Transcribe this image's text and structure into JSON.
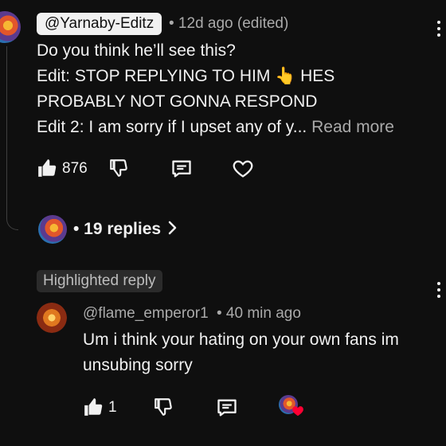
{
  "comment": {
    "author_handle": "@Yarnaby-Editz",
    "meta": "• 12d ago (edited)",
    "lines": [
      "Do you think he’ll see this?",
      "Edit: STOP REPLYING TO HIM 👆  HES",
      "PROBABLY NOT GONNA RESPOND",
      "Edit 2: I am sorry if I upset any of y..."
    ],
    "read_more": "Read more",
    "like_count": "876",
    "replies_label": "• 19 replies"
  },
  "highlighted": {
    "badge": "Highlighted reply",
    "author_handle": "@flame_emperor1",
    "meta": "• 40 min ago",
    "lines": [
      "Um i think your hating on your own fans im",
      "unsubing sorry"
    ],
    "like_count": "1"
  },
  "colors": {
    "background": "#0f0f0f",
    "text": "#f1f1f1",
    "secondary_text": "#aaaaaa",
    "heart_red": "#ff0033"
  },
  "icons": {
    "like": "thumbs-up-icon",
    "dislike": "thumbs-down-icon",
    "reply": "comment-icon",
    "heart": "heart-outline-icon",
    "more": "vertical-dots-icon",
    "chevron": "chevron-right-icon"
  }
}
